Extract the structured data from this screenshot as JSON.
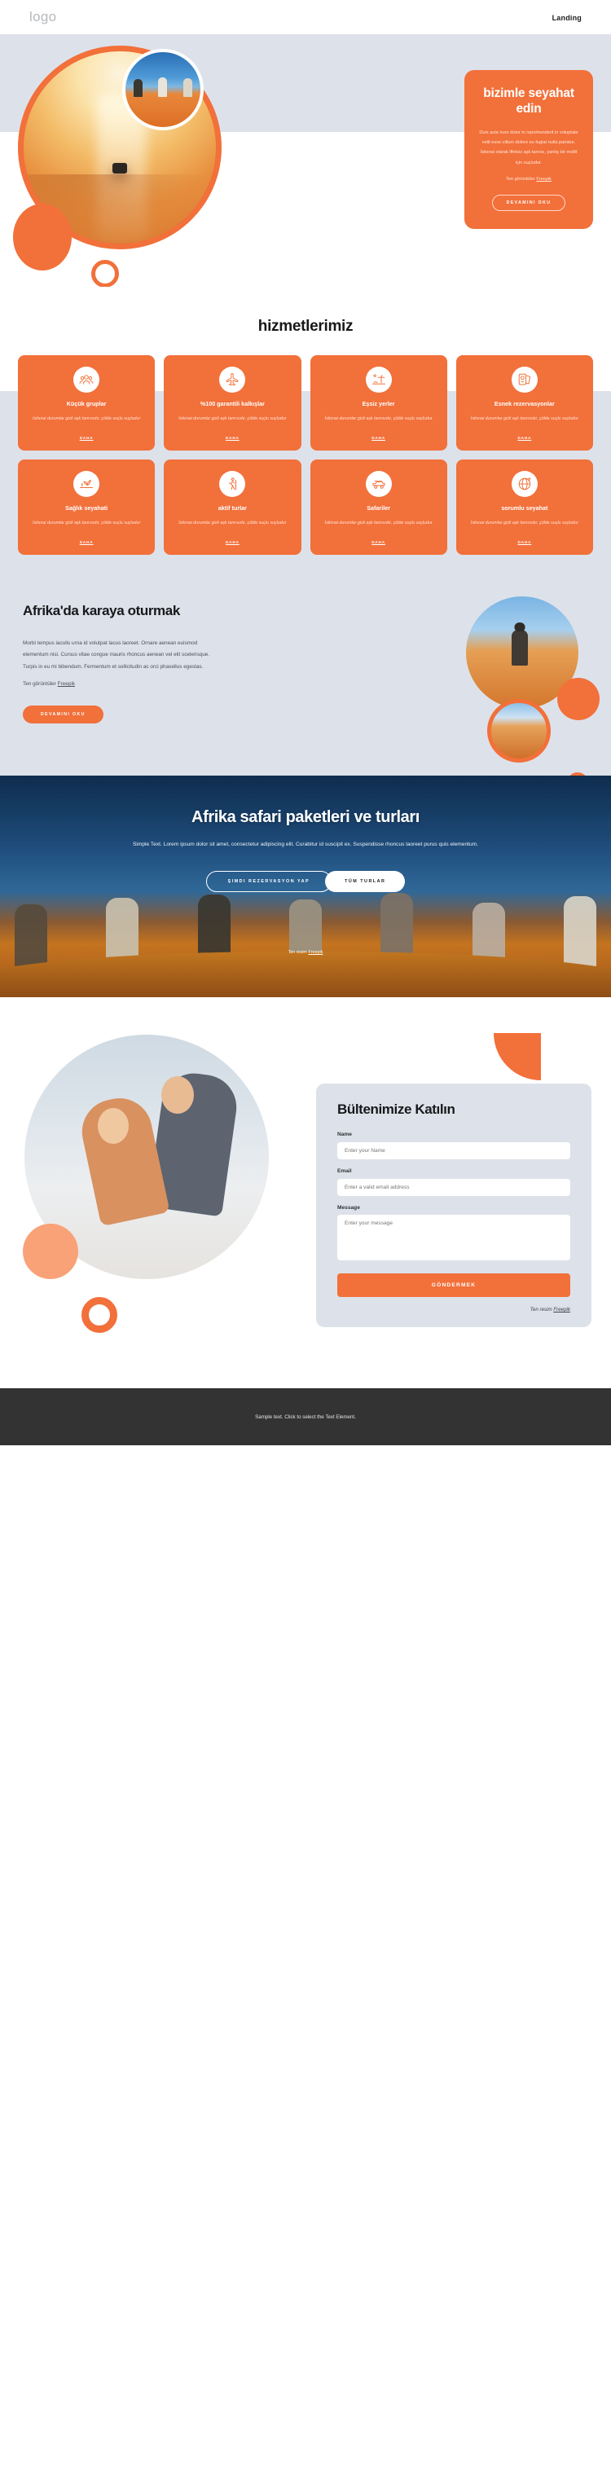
{
  "header": {
    "logo": "logo",
    "nav_link": "Landing"
  },
  "hero": {
    "title": "bizimle seyahat edin",
    "body": "Duis aute irure dolor in reprehenderit in voluptate velit esse cillum dolore eu fugiat nulla pariatur. İstisnai olarak iffetsiz aşk tanrısı, yanlış bir mollit için suçludur.",
    "credit_prefix": "Ten görüntüler ",
    "credit_link": "Freepik",
    "cta": "DEVAMINI OKU"
  },
  "services": {
    "heading": "hizmetlerimiz",
    "more_label": "DAHA",
    "description": "İstisnai durumlar gizli aşk tanrısıdır, çölde suçlu suçludur",
    "cards": [
      {
        "title": "Küçük gruplar",
        "icon": "group-people-icon"
      },
      {
        "title": "%100 garantili kalkışlar",
        "icon": "airplane-icon"
      },
      {
        "title": "Eşsiz yerler",
        "icon": "beach-palm-icon"
      },
      {
        "title": "Esnek rezervasyonlar",
        "icon": "passport-tickets-icon"
      },
      {
        "title": "Sağlık seyahati",
        "icon": "spa-wellness-icon"
      },
      {
        "title": "aktif turlar",
        "icon": "hiker-icon"
      },
      {
        "title": "Safariler",
        "icon": "safari-jeep-icon"
      },
      {
        "title": "sorumlu seyahat",
        "icon": "globe-plane-icon"
      }
    ]
  },
  "afrika": {
    "title": "Afrika'da karaya oturmak",
    "body": "Morbi tempus iaculis urna id volutpat lacus laoreet. Ornare aenean euismod elementum nisi. Cursus vitae congue mauris rhoncus aenean vel elit scelerisque. Turpis in eu mi bibendum. Fermentum et sollicitudin ac orci phasellus egestas.",
    "credit_prefix": "Ten görüntüler ",
    "credit_link": "Freepik",
    "cta": "DEVAMINI OKU"
  },
  "safari": {
    "title": "Afrika safari paketleri ve turları",
    "body": "Simple Text. Lorem ipsum dolor sit amet, consectetur adipiscing elit. Curabitur id suscipit ex. Suspendisse rhoncus laoreet purus quis elementum.",
    "btn_primary": "ŞIMDI REZERVASYON YAP",
    "btn_secondary": "TÜM TURLAR",
    "credit_prefix": "Ten resim ",
    "credit_link": "Freepik"
  },
  "newsletter": {
    "title": "Bültenimize Katılın",
    "name_label": "Name",
    "name_placeholder": "Enter your Name",
    "email_label": "Email",
    "email_placeholder": "Enter a valid email address",
    "message_label": "Message",
    "message_placeholder": "Enter your message",
    "submit_label": "GÖNDERMEK",
    "credit_prefix": "Ten resim ",
    "credit_link": "Freepik"
  },
  "footer": {
    "text": "Sample text. Click to select the Text Element."
  },
  "colors": {
    "accent": "#f2703a",
    "accent_light": "#f9a277",
    "band": "#dde2ea",
    "footer_bg": "#333333"
  }
}
